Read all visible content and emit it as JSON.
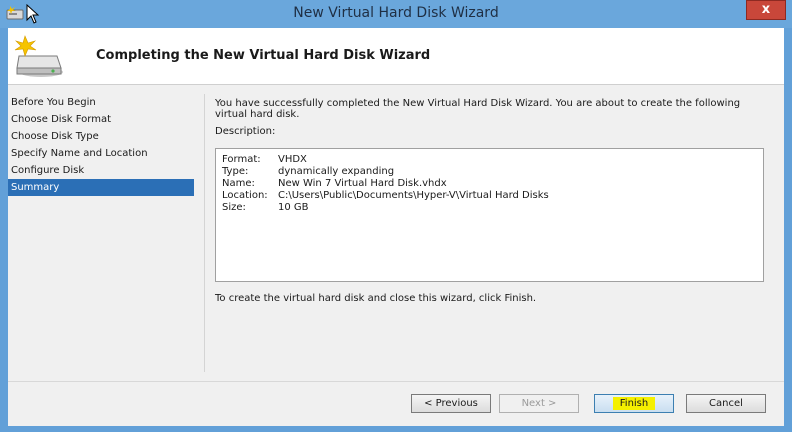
{
  "window": {
    "title": "New Virtual Hard Disk Wizard",
    "close_glyph": "x"
  },
  "header": {
    "title": "Completing the New Virtual Hard Disk Wizard",
    "icon": "hard-disk-sparkle-icon"
  },
  "nav": {
    "items": [
      {
        "label": "Before You Begin"
      },
      {
        "label": "Choose Disk Format"
      },
      {
        "label": "Choose Disk Type"
      },
      {
        "label": "Specify Name and Location"
      },
      {
        "label": "Configure Disk"
      },
      {
        "label": "Summary"
      }
    ],
    "selected": "Summary"
  },
  "content": {
    "intro": "You have successfully completed the New Virtual Hard Disk Wizard. You are about to create the following virtual hard disk.",
    "description_label": "Description:",
    "description": [
      {
        "key": "Format:",
        "value": "VHDX"
      },
      {
        "key": "Type:",
        "value": "dynamically expanding"
      },
      {
        "key": "Name:",
        "value": "New Win 7 Virtual Hard Disk.vhdx"
      },
      {
        "key": "Location:",
        "value": "C:\\Users\\Public\\Documents\\Hyper-V\\Virtual Hard Disks"
      },
      {
        "key": "Size:",
        "value": "10 GB"
      }
    ],
    "finish_note": "To create the virtual hard disk and close this wizard, click Finish."
  },
  "buttons": {
    "previous": "< Previous",
    "next": "Next >",
    "finish": "Finish",
    "cancel": "Cancel"
  },
  "colors": {
    "selected_nav": "#2b6fb6",
    "title_bar": "#6aa7dc",
    "highlight": "#f5f000"
  }
}
